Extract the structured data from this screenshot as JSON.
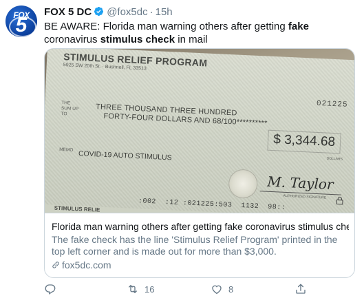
{
  "tweet": {
    "avatar": {
      "logo_text": "FOX",
      "logo_number": "5"
    },
    "display_name": "FOX 5 DC",
    "handle": "@fox5dc",
    "separator": "·",
    "time": "15h",
    "text": {
      "part1": "BE AWARE: Florida man warning others after getting ",
      "bold1": "fake",
      "part2": " coronavirus ",
      "bold2": "stimulus check",
      "part3": " in mail"
    }
  },
  "photo": {
    "check_title": "STIMULUS RELIEF PROGRAM",
    "check_address": "5925 SW 20th St. · Bushnell, FL 33513",
    "check_number": "021225",
    "sum_label": "THE SUM UP TO",
    "amount_words_line1": "THREE THOUSAND THREE HUNDRED",
    "amount_words_line2": "FORTY-FOUR DOLLARS AND 68/100**********",
    "amount": "$ 3,344.68",
    "dollars_label": "DOLLARS",
    "memo_label": "MEMO",
    "memo": "COVID-19 AUTO STIMULUS",
    "signature": "M. Taylor",
    "signature_label": "AUTHORIZED SIGNATURE",
    "micr_line": ":002  :12 :021225:503  1132  98::",
    "stub_text": "STIMULUS RELIE"
  },
  "card": {
    "title": "Florida man warning others after getting fake coronavirus stimulus chec...",
    "description": "The fake check has the line 'Stimulus Relief Program' printed in the top left corner and is made out for more than $3,000.",
    "domain": "fox5dc.com"
  },
  "actions": {
    "reply_count": "",
    "retweet_count": "16",
    "like_count": "8"
  },
  "colors": {
    "verified_blue": "#1da1f2",
    "secondary_text": "#657786",
    "border": "#ccd6dd"
  },
  "icons": [
    "verified-icon",
    "link-icon",
    "reply-icon",
    "retweet-icon",
    "like-icon",
    "share-icon"
  ]
}
